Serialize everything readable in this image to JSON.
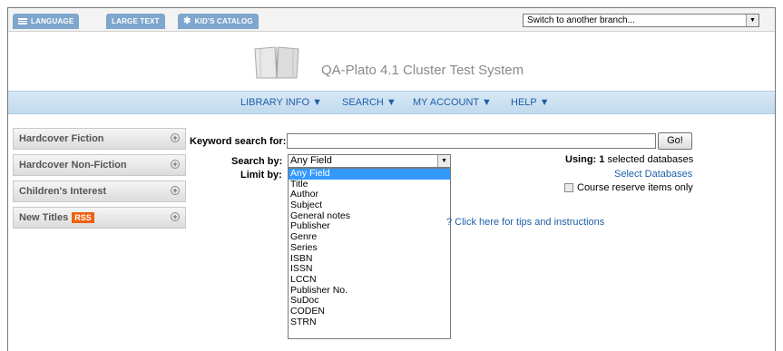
{
  "topbar": {
    "language_label": "LANGUAGE",
    "large_text_label": "LARGE TEXT",
    "kids_catalog_label": "KID'S CATALOG",
    "branch_select_value": "Switch to another branch...",
    "language_icon": "menu-icon",
    "kids_icon": "asterisk-icon"
  },
  "header": {
    "site_title": "QA-Plato 4.1 Cluster Test System",
    "logo_icon": "open-book-icon"
  },
  "nav": {
    "items": [
      {
        "label": "LIBRARY INFO ▼"
      },
      {
        "label": "SEARCH ▼"
      },
      {
        "label": "MY ACCOUNT ▼"
      },
      {
        "label": "HELP ▼"
      }
    ]
  },
  "sidebar": {
    "items": [
      {
        "label": "Hardcover Fiction"
      },
      {
        "label": "Hardcover Non-Fiction"
      },
      {
        "label": "Children's Interest"
      },
      {
        "label": "New Titles",
        "badge": "RSS"
      }
    ],
    "expand_icon": "plus-circle-icon"
  },
  "search": {
    "keyword_label": "Keyword search for:",
    "keyword_value": "",
    "go_label": "Go!",
    "search_by_label": "Search by:",
    "search_by_value": "Any Field",
    "limit_by_label": "Limit by:",
    "options": [
      "Any Field",
      "Title",
      "Author",
      "Subject",
      "General notes",
      "Publisher",
      "Genre",
      "Series",
      "ISBN",
      "ISSN",
      "LCCN",
      "Publisher No.",
      "SuDoc",
      "CODEN",
      "STRN"
    ],
    "using_prefix": "Using:",
    "using_count": "1",
    "using_suffix": "selected databases",
    "select_databases_label": "Select Databases",
    "course_reserve_label": "Course reserve items only",
    "tips_label": "? Click here for tips and instructions"
  },
  "colors": {
    "tab_blue": "#7fa6cc",
    "nav_link": "#1e5fa8",
    "selected_option": "#3399ff",
    "rss_orange": "#f06010"
  }
}
